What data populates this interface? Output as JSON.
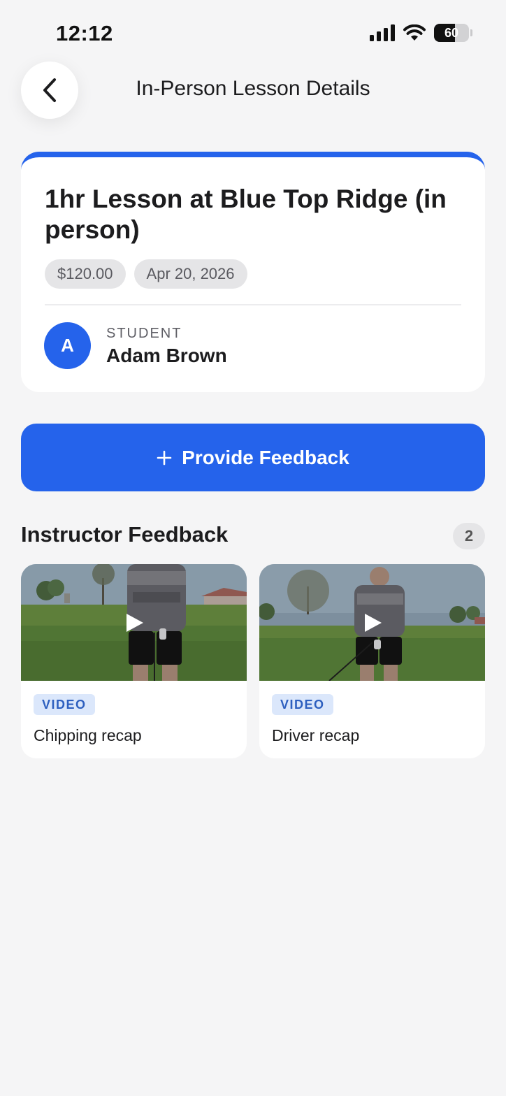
{
  "status_bar": {
    "time": "12:12",
    "battery": "60",
    "battery_level": 0.6
  },
  "header": {
    "title": "In-Person Lesson Details"
  },
  "lesson": {
    "title": "1hr Lesson at Blue Top Ridge (in person)",
    "price": "$120.00",
    "date": "Apr 20, 2026",
    "student_label": "STUDENT",
    "student_name": "Adam Brown",
    "student_initial": "A"
  },
  "actions": {
    "provide_feedback": "Provide Feedback",
    "provide_feedback_icon": "plus-icon"
  },
  "feedback_section": {
    "title": "Instructor Feedback",
    "count": "2",
    "items": [
      {
        "tag": "VIDEO",
        "title": "Chipping recap"
      },
      {
        "tag": "VIDEO",
        "title": "Driver recap"
      }
    ]
  },
  "colors": {
    "accent": "#2563eb",
    "tag_bg": "#dbe7fb",
    "tag_text": "#2d5fbf"
  }
}
